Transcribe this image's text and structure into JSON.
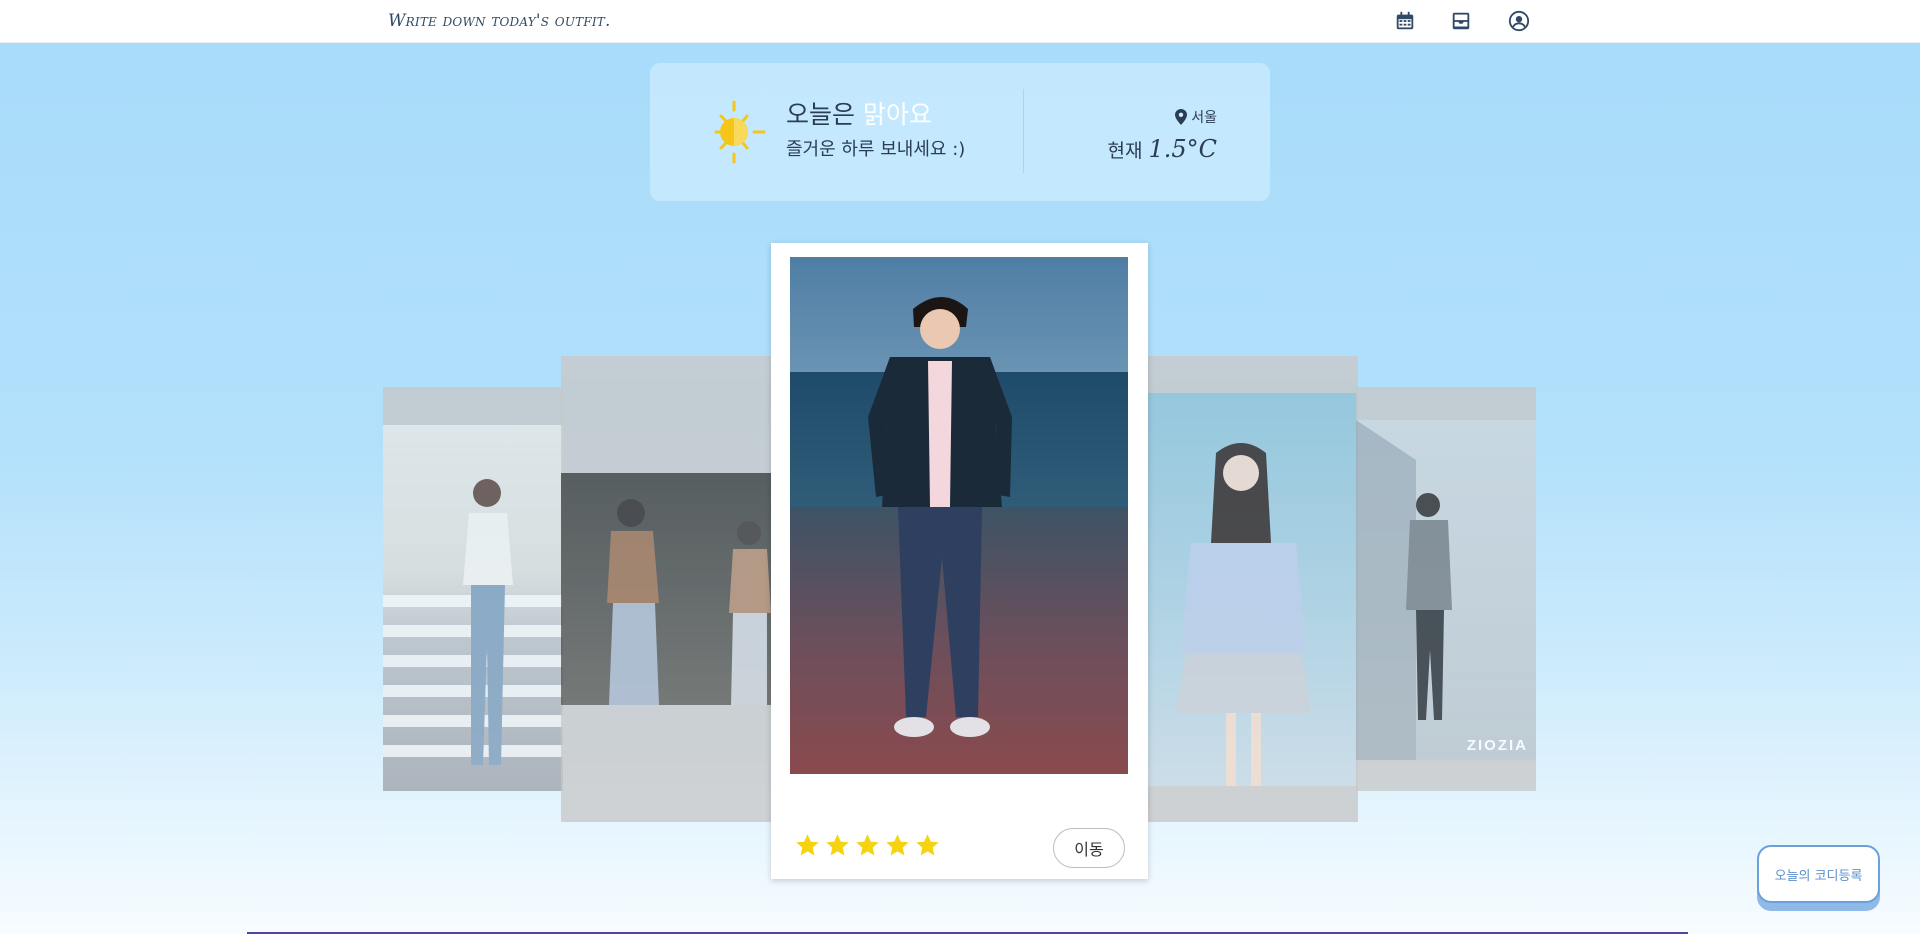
{
  "header": {
    "brand": "Write down today's outfit.",
    "icons": [
      "calendar-icon",
      "inbox-icon",
      "user-circle-icon"
    ]
  },
  "weather": {
    "line1_prefix": "오늘은",
    "condition": "맑아요",
    "line2": "즐거운 하루 보내세요 :)",
    "location": "서울",
    "temp_label": "현재",
    "temp_value": "1.5°C",
    "icon": "sun-icon"
  },
  "carousel": {
    "cards": [
      {
        "name": "outfit-card-1",
        "position": "far-left",
        "caption": ""
      },
      {
        "name": "outfit-card-2",
        "position": "left",
        "caption": ""
      },
      {
        "name": "outfit-card-3",
        "position": "center",
        "caption": ""
      },
      {
        "name": "outfit-card-4",
        "position": "right",
        "caption": ""
      },
      {
        "name": "outfit-card-5",
        "position": "far-right",
        "watermark": "ZIOZIA"
      }
    ],
    "rating": 5,
    "rating_max": 5,
    "move_label": "이동"
  },
  "register_button": "오늘의 코디등록",
  "colors": {
    "accent": "#5b8fd0",
    "star": "#f5d40f",
    "sky_top": "#a8dcfa"
  }
}
